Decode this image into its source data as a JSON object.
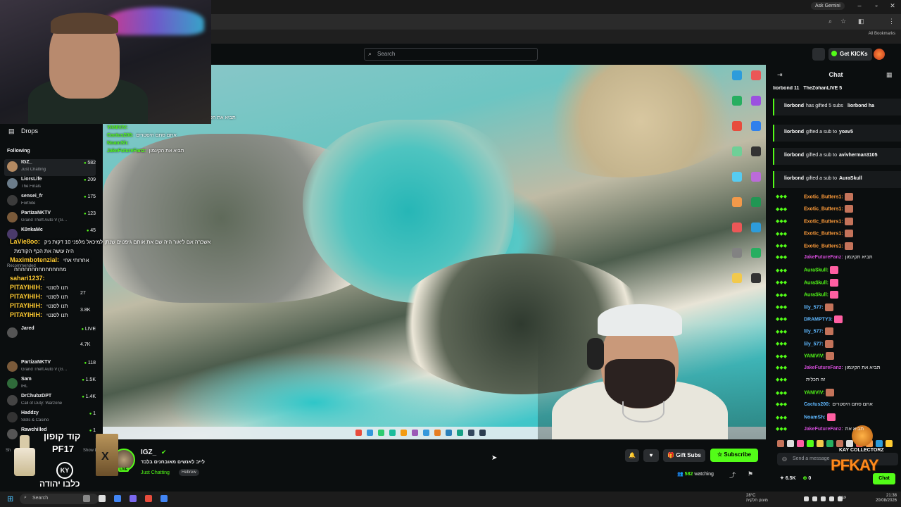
{
  "browser": {
    "ask_gemini": "Ask Gemini",
    "all_bookmarks": "All Bookmarks"
  },
  "header": {
    "search_placeholder": "Search",
    "get_kicks_label": "Get KICKs"
  },
  "sidebar": {
    "drops_label": "Drops",
    "following_label": "Following",
    "recommended_label": "Recommended",
    "show_less_label": "Show Less",
    "show_more_label": "Sh",
    "following": [
      {
        "name": "IGZ_",
        "category": "Just Chatting",
        "viewers": "582",
        "color": "#b48a62"
      },
      {
        "name": "LiorsLife",
        "category": "The Finals",
        "viewers": "209",
        "color": "#6b7c8a"
      },
      {
        "name": "sensei_fr",
        "category": "Fortnite",
        "viewers": "175",
        "color": "#3b3b3b"
      },
      {
        "name": "PartizaNKTV",
        "category": "Grand Theft Auto V (G…",
        "viewers": "123",
        "color": "#7a5a3a"
      },
      {
        "name": "K0nkaMc",
        "category": "",
        "viewers": "45",
        "color": "#4a3a6a"
      }
    ],
    "recommended": [
      {
        "name": "Jared",
        "category": "",
        "viewers": "LIVE",
        "color": "#555"
      },
      {
        "name": "PartizaNKTV",
        "category": "Grand Theft Auto V (G…",
        "viewers": "118",
        "color": "#7a5a3a"
      },
      {
        "name": "Sam",
        "category": "IRL",
        "viewers": "1.5K",
        "color": "#2f6b3a"
      },
      {
        "name": "DrChubzDPT",
        "category": "Call of Duty: Warzone",
        "viewers": "1.4K",
        "color": "#444"
      },
      {
        "name": "Haddzy",
        "category": "Slots & Casino",
        "viewers": "1",
        "color": "#333"
      },
      {
        "name": "Rawchilled",
        "category": "",
        "viewers": "1",
        "color": "#555"
      }
    ],
    "partial_recommended": [
      {
        "viewers": "27"
      },
      {
        "viewers": "3.8K"
      },
      {
        "viewers": "4.7K"
      }
    ]
  },
  "video_overlay": {
    "chat": [
      {
        "name": "YANIVIV:",
        "text": ""
      },
      {
        "name": "Cactus200:",
        "text": "אתם סתם היסטרים"
      },
      {
        "name": "NoamSh:",
        "text": ""
      },
      {
        "name": "JakeFutureFanz:",
        "text": "תביא את הקינמון"
      }
    ],
    "top_text": "תביא את הקי",
    "lines": [
      {
        "name": "LaVie8oo:",
        "text": "אשכרה אם ליאור היה שם את אותם גיפטים שנתן למיכאל מלפני 10 דקות ניק"
      },
      {
        "name": "",
        "text": "היה עושה את הכף הקודמת"
      },
      {
        "name": "Maximbotenzial:",
        "text": "אחרותי אחי"
      },
      {
        "name": "",
        "text": "מחחחחחחחחחחחחחח"
      },
      {
        "name": "sahari1237:",
        "text": ""
      },
      {
        "name": "PITAYIHIH:",
        "text": "תנו לסנטי"
      },
      {
        "name": "PITAYIHIH:",
        "text": "תנו לסנטי"
      },
      {
        "name": "PITAYIHIH:",
        "text": "תנו לסנטי"
      },
      {
        "name": "PITAYIHIH:",
        "text": "תנו לסנטי"
      }
    ]
  },
  "stream": {
    "streamer_name": "IGZ_",
    "title": "לייב לאנשים מאובחנים בלבד",
    "category": "Just Chatting",
    "language": "Hebrew",
    "viewers": "582",
    "watching_label": "watching",
    "gift_subs_label": "Gift Subs",
    "subscribe_label": "Subscribe",
    "live_badge": "LIVE"
  },
  "chat": {
    "title": "Chat",
    "gifters": [
      "liorbond 11",
      "TheZohanLIVE 5"
    ],
    "pinned": [
      {
        "user": "liorbond",
        "text": "has gifted 5 subs",
        "extra": "liorbond ha"
      },
      {
        "user": "liorbond",
        "text": "gifted a sub to",
        "target": "yoav5"
      },
      {
        "user": "liorbond",
        "text": "gifted a sub to",
        "target": "avivherman3105"
      },
      {
        "user": "liorbond",
        "text": "gifted a sub to",
        "target": "AuraSkull"
      }
    ],
    "messages": [
      {
        "user": "Exotic_Butters1:",
        "text": "",
        "color": "#ff9c3a",
        "emote": "#c4735a"
      },
      {
        "user": "Exotic_Butters1:",
        "text": "",
        "color": "#ff9c3a",
        "emote": "#c4735a"
      },
      {
        "user": "Exotic_Butters1:",
        "text": "",
        "color": "#ff9c3a",
        "emote": "#c4735a"
      },
      {
        "user": "Exotic_Butters1:",
        "text": "",
        "color": "#ff9c3a",
        "emote": "#c4735a"
      },
      {
        "user": "Exotic_Butters1:",
        "text": "",
        "color": "#ff9c3a",
        "emote": "#c4735a"
      },
      {
        "user": "JakeFutureFanz:",
        "text": "תביא תקינמון",
        "color": "#d04bd6",
        "emote": ""
      },
      {
        "user": "AuraSkull:",
        "text": "",
        "color": "#53fc18",
        "emote": "#ff5fa2"
      },
      {
        "user": "AuraSkull:",
        "text": "",
        "color": "#53fc18",
        "emote": "#ff5fa2"
      },
      {
        "user": "AuraSkull:",
        "text": "",
        "color": "#53fc18",
        "emote": "#ff5fa2"
      },
      {
        "user": "lily_577:",
        "text": "",
        "color": "#5fb8ff",
        "emote": "#c4735a"
      },
      {
        "user": "DRAMPTY3:",
        "text": "",
        "color": "#5fb8ff",
        "emote": "#ff5fa2"
      },
      {
        "user": "lily_577:",
        "text": "",
        "color": "#5fb8ff",
        "emote": "#c4735a"
      },
      {
        "user": "lily_577:",
        "text": "",
        "color": "#5fb8ff",
        "emote": "#c4735a"
      },
      {
        "user": "YANIVIV:",
        "text": "",
        "color": "#53fc18",
        "emote": "#c4735a"
      },
      {
        "user": "JakeFutureFanz:",
        "text": "תביא את הקינמון",
        "color": "#d04bd6",
        "emote": ""
      },
      {
        "user": "",
        "text": "זה תכלית",
        "color": "#efeff1",
        "emote": ""
      },
      {
        "user": "YANIVIV:",
        "text": "",
        "color": "#53fc18",
        "emote": "#c4735a"
      },
      {
        "user": "Cactus200:",
        "text": "אתם סתם היסטרים",
        "color": "#5fb8ff",
        "emote": ""
      },
      {
        "user": "NoamSh:",
        "text": "",
        "color": "#5fb8ff",
        "emote": "#ff5fa2"
      },
      {
        "user": "JakeFutureFanz:",
        "text": "תביא את",
        "color": "#d04bd6",
        "emote": ""
      }
    ],
    "input_placeholder": "Send a message",
    "stat_kicks": "6.5K",
    "stat_other": "0",
    "send_label": "Chat"
  },
  "overlays": {
    "promo_line1": "קוד קופון",
    "promo_line2": "PF17",
    "promo_ky": "KY",
    "promo_line3": "כלבו יהודה",
    "pfkay_title": "KAY COLLECTORZ",
    "pfkay_logo": "PFKAY"
  },
  "taskbar": {
    "search_label": "Search",
    "weather_temp": "28°C",
    "weather_text": "מעונן חלקית",
    "lang": "עבר",
    "time": "21:38",
    "date": "20/08/2026"
  },
  "colors": {
    "accent": "#53fc18",
    "background": "#0b0e0f"
  }
}
